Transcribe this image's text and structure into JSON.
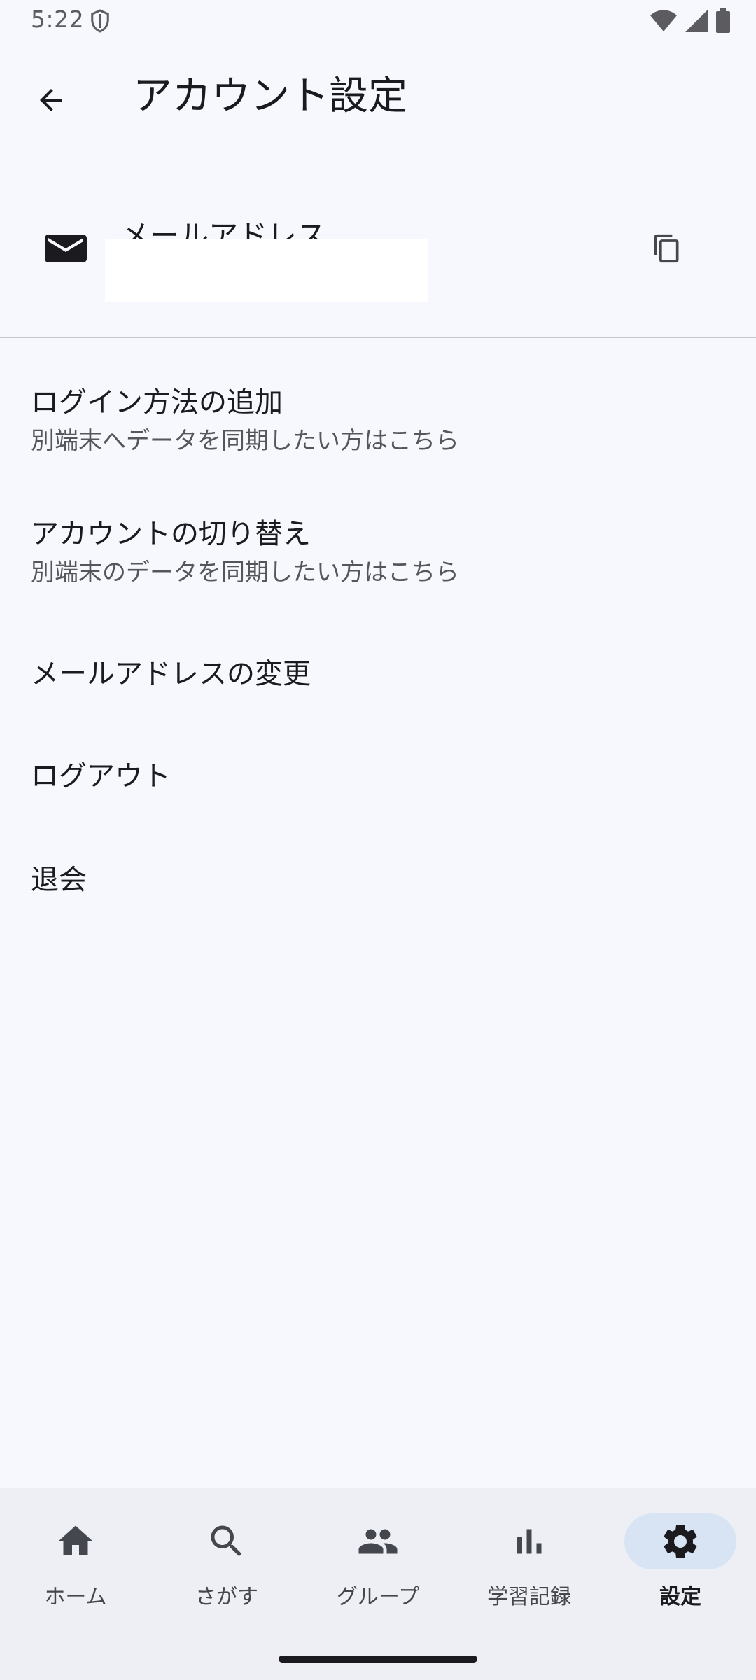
{
  "status_bar": {
    "time": "5:22"
  },
  "app_bar": {
    "title": "アカウント設定"
  },
  "email_section": {
    "label": "メールアドレス"
  },
  "menu": [
    {
      "title": "ログイン方法の追加",
      "subtitle": "別端末へデータを同期したい方はこちら"
    },
    {
      "title": "アカウントの切り替え",
      "subtitle": "別端末のデータを同期したい方はこちら"
    },
    {
      "title": "メールアドレスの変更"
    },
    {
      "title": "ログアウト"
    },
    {
      "title": "退会"
    }
  ],
  "bottom_nav": [
    {
      "label": "ホーム",
      "icon": "home-icon"
    },
    {
      "label": "さがす",
      "icon": "search-icon"
    },
    {
      "label": "グループ",
      "icon": "group-icon"
    },
    {
      "label": "学習記録",
      "icon": "bar-chart-icon"
    },
    {
      "label": "設定",
      "icon": "gear-icon",
      "active": true
    }
  ],
  "colors": {
    "background": "#f7f8fd",
    "nav_background": "#eeeff4",
    "active_pill": "#d8e4f4"
  }
}
